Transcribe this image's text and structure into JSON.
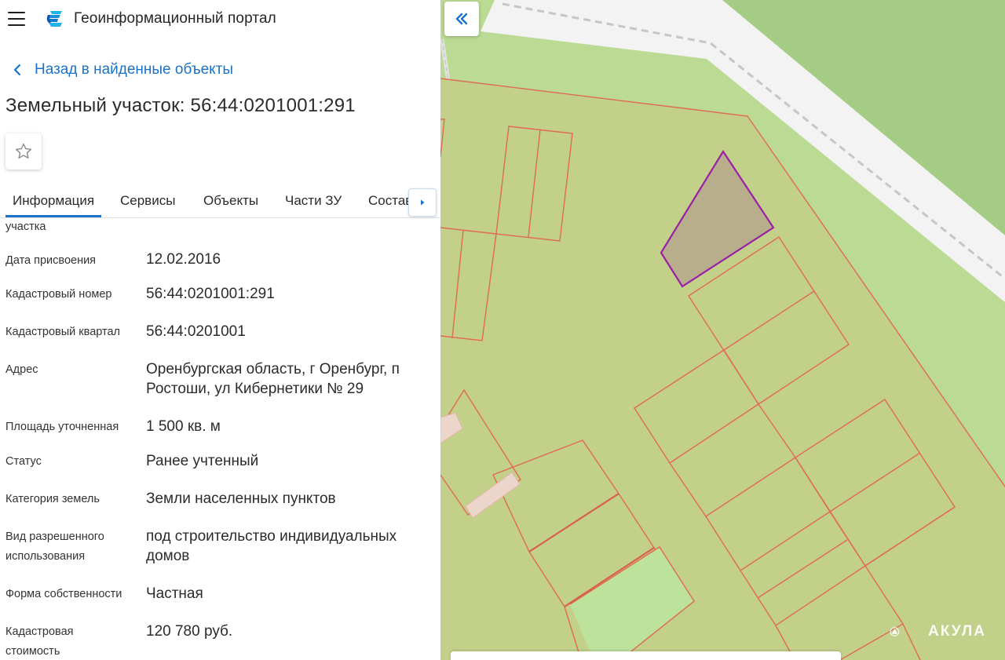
{
  "app": {
    "title": "Геоинформационный портал"
  },
  "nav": {
    "back_label": "Назад в найденные объекты"
  },
  "object": {
    "title": "Земельный участок: 56:44:0201001:291"
  },
  "tabs": [
    {
      "label": "Информация",
      "active": true
    },
    {
      "label": "Сервисы",
      "active": false
    },
    {
      "label": "Объекты",
      "active": false
    },
    {
      "label": "Части ЗУ",
      "active": false
    },
    {
      "label": "Состав",
      "active": false
    }
  ],
  "info": {
    "cut_label": "участка",
    "rows": [
      {
        "label": [
          "Дата присвоения"
        ],
        "value": [
          "12.02.2016"
        ]
      },
      {
        "label": [
          "Кадастровый номер"
        ],
        "value": [
          "56:44:0201001:291"
        ]
      },
      {
        "label": [
          "Кадастровый квартал"
        ],
        "value": [
          "56:44:0201001"
        ]
      },
      {
        "label": [
          "Адрес"
        ],
        "value": [
          "Оренбургская область, г Оренбург, п",
          "Ростоши, ул Кибернетики № 29"
        ]
      },
      {
        "label": [
          "Площадь уточненная"
        ],
        "value": [
          "1 500 кв. м"
        ]
      },
      {
        "label": [
          "Статус"
        ],
        "value": [
          "Ранее учтенный"
        ]
      },
      {
        "label": [
          "Категория земель"
        ],
        "value": [
          "Земли населенных пунктов"
        ]
      },
      {
        "label": [
          "Вид разрешенного",
          "использования"
        ],
        "value": [
          "под строительство индивидуальных",
          "домов"
        ]
      },
      {
        "label": [
          "Форма собственности"
        ],
        "value": [
          "Частная"
        ]
      },
      {
        "label": [
          "Кадастровая",
          "стоимость"
        ],
        "value": [
          "120 780 руб."
        ]
      }
    ]
  },
  "map": {
    "watermark": "АКУЛА",
    "colors": {
      "land": "#bbdb95",
      "forest": "#a4cc84",
      "road": "#f3f3f3",
      "parcel_fill": "#c2d08a",
      "parcel_line": "#e06a52",
      "selected_fill": "#b8ae8c",
      "selected_line": "#9a1fa6",
      "building": "#ecd6cc"
    }
  },
  "icons": {
    "menu": "hamburger-icon",
    "logo": "portal-logo-icon",
    "back": "chevron-left-icon",
    "favorite": "star-outline-icon",
    "tabs_next": "caret-right-icon",
    "collapse": "double-chevron-left-icon"
  },
  "accent": "#1a73c8"
}
